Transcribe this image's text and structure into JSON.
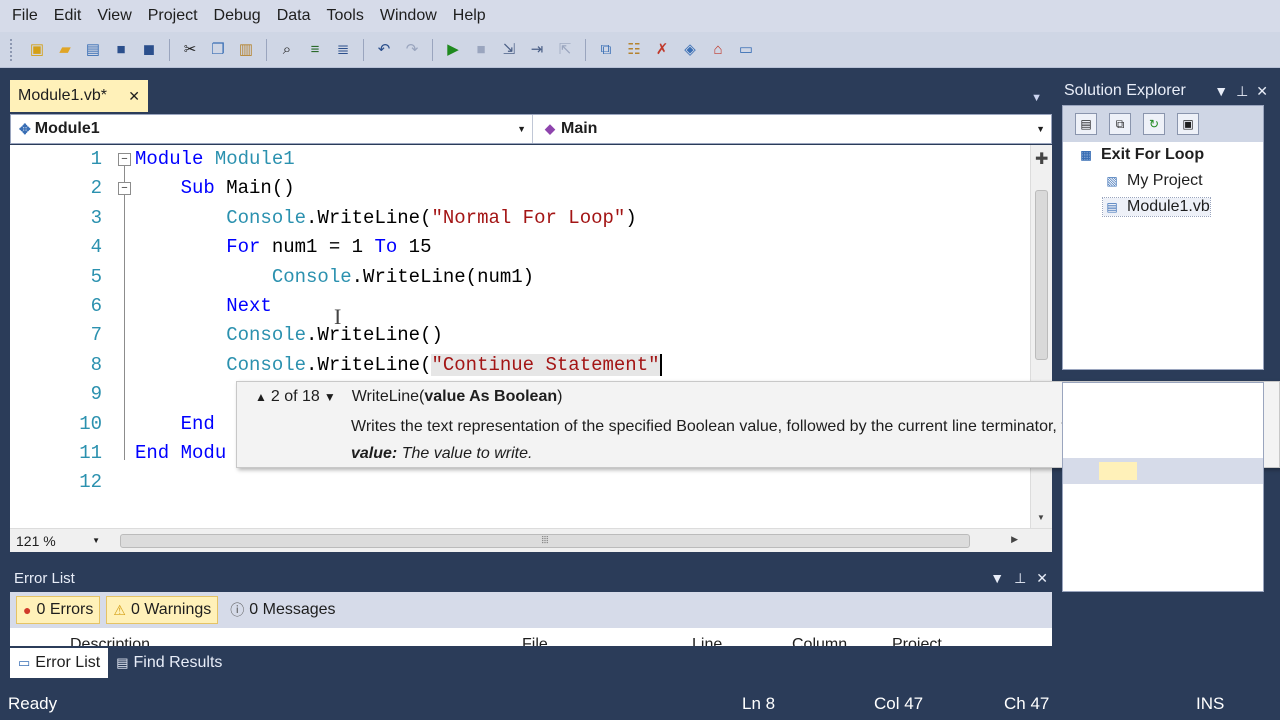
{
  "menu": [
    "File",
    "Edit",
    "View",
    "Project",
    "Debug",
    "Data",
    "Tools",
    "Window",
    "Help"
  ],
  "toolbar": {
    "icons": [
      "new-project",
      "open-file",
      "add-item",
      "save",
      "save-all",
      "cut",
      "copy",
      "paste",
      "find",
      "comment",
      "uncomment",
      "undo",
      "redo",
      "start-debugging",
      "stop",
      "step-into",
      "step-over",
      "step-out",
      "solution-explorer",
      "properties",
      "toolbox",
      "object-browser",
      "start-page",
      "error-list"
    ]
  },
  "document_tab": {
    "label": "Module1.vb*",
    "close": "✕"
  },
  "nav": {
    "left": "Module1",
    "right": "Main"
  },
  "editor": {
    "line_numbers": [
      "1",
      "2",
      "3",
      "4",
      "5",
      "6",
      "7",
      "8",
      "9",
      "10",
      "11",
      "12"
    ],
    "lines": [
      [
        {
          "t": "kw",
          "v": "Module "
        },
        {
          "t": "tp",
          "v": "Module1"
        }
      ],
      [
        {
          "t": "pl",
          "v": "    "
        },
        {
          "t": "kw",
          "v": "Sub "
        },
        {
          "t": "pl",
          "v": "Main()"
        }
      ],
      [
        {
          "t": "pl",
          "v": "        "
        },
        {
          "t": "tp",
          "v": "Console"
        },
        {
          "t": "pl",
          "v": ".WriteLine("
        },
        {
          "t": "st",
          "v": "\"Normal For Loop\""
        },
        {
          "t": "pl",
          "v": ")"
        }
      ],
      [
        {
          "t": "pl",
          "v": "        "
        },
        {
          "t": "kw",
          "v": "For "
        },
        {
          "t": "pl",
          "v": "num1 = 1 "
        },
        {
          "t": "kw",
          "v": "To "
        },
        {
          "t": "pl",
          "v": "15"
        }
      ],
      [
        {
          "t": "pl",
          "v": "            "
        },
        {
          "t": "tp",
          "v": "Console"
        },
        {
          "t": "pl",
          "v": ".WriteLine(num1)"
        }
      ],
      [
        {
          "t": "pl",
          "v": "        "
        },
        {
          "t": "kw",
          "v": "Next"
        }
      ],
      [
        {
          "t": "pl",
          "v": "        "
        },
        {
          "t": "tp",
          "v": "Console"
        },
        {
          "t": "pl",
          "v": ".WriteLine()"
        }
      ],
      [
        {
          "t": "pl",
          "v": "        "
        },
        {
          "t": "tp",
          "v": "Console"
        },
        {
          "t": "pl",
          "v": ".WriteLine("
        },
        {
          "t": "st-hl",
          "v": "\"Continue Statement\""
        },
        {
          "t": "caret",
          "v": ""
        }
      ],
      [],
      [
        {
          "t": "pl",
          "v": "    "
        },
        {
          "t": "kw",
          "v": "End "
        }
      ],
      [
        {
          "t": "kw",
          "v": "End Modu"
        }
      ],
      []
    ],
    "zoom": "121 %"
  },
  "tooltip": {
    "counter": "2 of 18",
    "method": "WriteLine(",
    "params_bold": "value As Boolean",
    "close_paren": ")",
    "description": "Writes the text representation of the specified Boolean value, followed by the current line terminator, to the standard output",
    "param_name": "value:",
    "param_desc": "The value to write."
  },
  "solution_explorer": {
    "title": "Solution Explorer",
    "items": [
      {
        "label": "Exit For Loop",
        "icon": "solution-icon",
        "bold": true
      },
      {
        "label": "My Project",
        "icon": "project-properties-icon"
      },
      {
        "label": "Module1.vb",
        "icon": "vb-file-icon",
        "selected": true
      }
    ]
  },
  "error_list": {
    "title": "Error List",
    "filters": [
      {
        "label": "0 Errors",
        "icon": "error-icon",
        "active": true
      },
      {
        "label": "0 Warnings",
        "icon": "warning-icon",
        "active": true
      },
      {
        "label": "0 Messages",
        "icon": "info-icon",
        "active": false
      }
    ],
    "columns": [
      "Description",
      "File",
      "Line",
      "Column",
      "Project"
    ]
  },
  "bottom_tabs": [
    "Error List",
    "Find Results"
  ],
  "status": {
    "ready": "Ready",
    "ln": "Ln 8",
    "col": "Col 47",
    "ch": "Ch 47",
    "ins": "INS"
  },
  "colors": {
    "chrome": "#2b3c59",
    "tab_active": "#fff1b9",
    "keyword": "#0000ff",
    "type": "#2b91af",
    "string": "#a31515"
  }
}
